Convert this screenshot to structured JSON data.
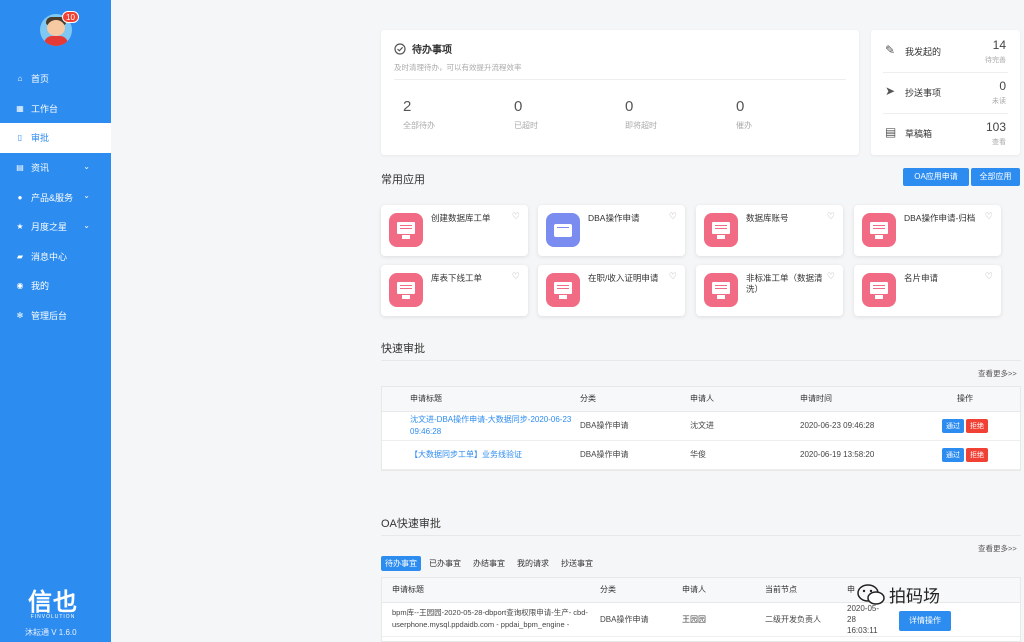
{
  "user": {
    "badge_count": "10"
  },
  "sidebar": {
    "items": [
      {
        "label": "首页",
        "icon": "home-icon",
        "glyph": "⌂",
        "chevron": false,
        "active": false
      },
      {
        "label": "工作台",
        "icon": "grid-icon",
        "glyph": "▦",
        "chevron": false,
        "active": false
      },
      {
        "label": "审批",
        "icon": "document-icon",
        "glyph": "▯",
        "chevron": false,
        "active": true
      },
      {
        "label": "资讯",
        "icon": "news-icon",
        "glyph": "▤",
        "chevron": true,
        "active": false
      },
      {
        "label": "产品&服务",
        "icon": "product-icon",
        "glyph": "●",
        "chevron": true,
        "active": false
      },
      {
        "label": "月度之星",
        "icon": "star-icon",
        "glyph": "★",
        "chevron": true,
        "active": false
      },
      {
        "label": "消息中心",
        "icon": "message-icon",
        "glyph": "▰",
        "chevron": false,
        "active": false
      },
      {
        "label": "我的",
        "icon": "user-icon",
        "glyph": "◉",
        "chevron": false,
        "active": false
      },
      {
        "label": "管理后台",
        "icon": "gear-icon",
        "glyph": "✻",
        "chevron": false,
        "active": false
      }
    ],
    "logo_text": "信也",
    "logo_sub": "FINVOLUTION",
    "version": "沐耘通 V 1.6.0"
  },
  "todo": {
    "title": "待办事项",
    "subtitle": "及时清理待办，可以有效提升流程效率",
    "stats": [
      {
        "num": "2",
        "label": "全部待办"
      },
      {
        "num": "0",
        "label": "已超时"
      },
      {
        "num": "0",
        "label": "即将超时"
      },
      {
        "num": "0",
        "label": "催办"
      }
    ]
  },
  "side_stats": [
    {
      "label": "我发起的",
      "num": "14",
      "sub": "待完善",
      "icon": "edit-icon",
      "glyph": "✎"
    },
    {
      "label": "抄送事项",
      "num": "0",
      "sub": "未读",
      "icon": "send-icon",
      "glyph": "➤"
    },
    {
      "label": "草稿箱",
      "num": "103",
      "sub": "查看",
      "icon": "draft-icon",
      "glyph": "▤"
    }
  ],
  "common_apps": {
    "title": "常用应用",
    "btn_oa": "OA应用申请",
    "btn_all": "全部应用",
    "apps": [
      {
        "name": "创建数据库工单"
      },
      {
        "name": "DBA操作申请"
      },
      {
        "name": "数据库账号"
      },
      {
        "name": "DBA操作申请-归档"
      },
      {
        "name": "库表下线工单"
      },
      {
        "name": "在职/收入证明申请"
      },
      {
        "name": "非标准工单（数据清洗）"
      },
      {
        "name": "名片申请"
      }
    ]
  },
  "quick_approval": {
    "title": "快速审批",
    "more": "查看更多>>",
    "headers": [
      "申请标题",
      "分类",
      "申请人",
      "申请时间",
      "操作"
    ],
    "rows": [
      {
        "title": "沈文进-DBA操作申请-大数据同步-2020-06-23 09:46:28",
        "category": "DBA操作申请",
        "applicant": "沈文进",
        "time": "2020-06-23 09:46:28"
      },
      {
        "title": "【大数据同步工单】业务线验证",
        "category": "DBA操作申请",
        "applicant": "华俊",
        "time": "2020-06-19 13:58:20"
      }
    ],
    "pass": "通过",
    "reject": "拒绝"
  },
  "oa_approval": {
    "title": "OA快速审批",
    "more": "查看更多>>",
    "tabs": [
      "待办事宜",
      "已办事宜",
      "办结事宜",
      "我的请求",
      "抄送事宜"
    ],
    "headers": [
      "申请标题",
      "分类",
      "申请人",
      "当前节点",
      "申"
    ],
    "row": {
      "title": "bpm库--王园园-2020-05-28-dbport查询权限申请-生产- cbd-userphone.mysql.ppdaidb.com - ppdai_bpm_engine -",
      "category": "DBA操作申请",
      "applicant": "王园园",
      "node": "二级开发负责人",
      "time": "2020-05-28 16:03:11",
      "action": "详情操作"
    }
  },
  "watermark": {
    "text": "拍码场"
  }
}
